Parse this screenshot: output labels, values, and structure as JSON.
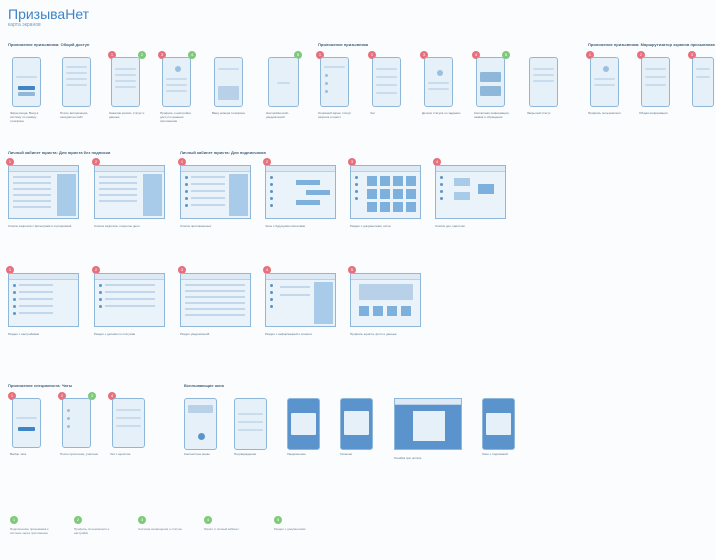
{
  "header": {
    "title": "ПризываНет",
    "subtitle": "карта экранов"
  },
  "sections": {
    "s1": "Приложение призывника: Общий доступ",
    "s2": "Приложение призывника",
    "s3": "Приложение призывника: Маршрутизатор экранов призывника",
    "s4": "Личный кабинет юриста: Для юриста без подписки",
    "s5": "Личный кабинет юриста: Для подписчиков",
    "s6": "Приложение специалиста: Чаты",
    "s7": "Всплывающие окна"
  },
  "badges": {
    "n1": "1",
    "n2": "2",
    "n3": "3",
    "n4": "4",
    "n5": "5",
    "n6": "6"
  },
  "captions": {
    "c1": "Экран входа. Вход в систему по номеру телефона",
    "c2": "После авторизации, заходим на сайт",
    "c3": "Нажатие кнопки, статус и данные",
    "c4": "Профиль и настройки, доступ к данным приложения",
    "c5": "Ввод номера телефона",
    "c6": "Настройка push-уведомлений",
    "c7": "Основной экран: статус запроса и юрист",
    "c8": "Чат",
    "c9": "Детали статуса по заданию",
    "c10": "Контактная информация, заявка и обращения",
    "c11": "Закрытый статус",
    "c12": "Профиль пользователя",
    "c13": "Общая информация",
    "c14": "Список запросов с фильтрами и сортировкой",
    "c15": "Список запросов, открытое дело",
    "c16": "Список приглашенных",
    "c17": "Чаты с будущими клиентами",
    "c18": "Раздел с документами, сетка",
    "c19": "Список дел, карточки",
    "c20": "Раздел с настройками",
    "c21": "Раздел с делами по статусам",
    "c22": "Раздел уведомлений",
    "c23": "Раздел с информацией о клиенте",
    "c24": "Профиль юриста, фото и данные",
    "c25": "Выбор чата",
    "c26": "После прочтения, участник",
    "c27": "Чат с юристом",
    "c28": "Контекстное меню",
    "c29": "Подтверждение",
    "c30": "Уведомление",
    "c31": "Успешно",
    "c32": "Ошибка при оплате",
    "c33": "Окно с подсказкой",
    "c34": "Окно выбора"
  },
  "notes": {
    "n1": "Подключение призывника к системе через приложение",
    "n2": "Профиль пользователя и настройки",
    "n3": "Система оповещения о статусе",
    "n4": "Юрист и личный кабинет",
    "n5": "Раздел с документами"
  }
}
